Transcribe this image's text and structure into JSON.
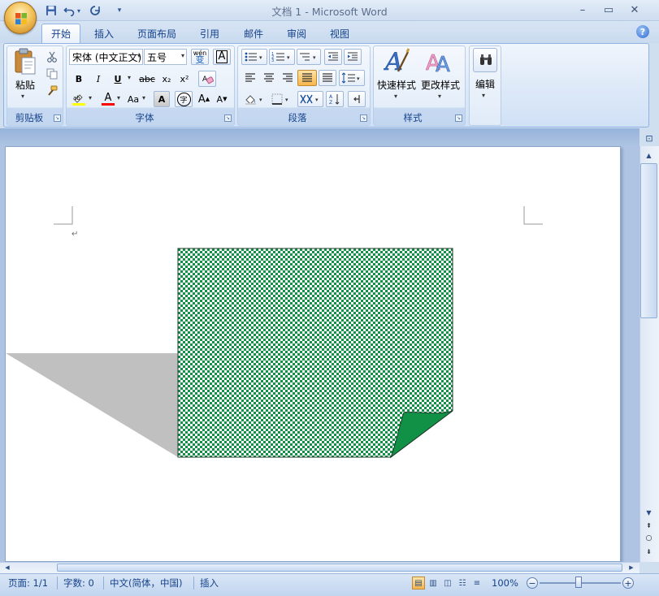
{
  "window": {
    "title": "文档 1 - Microsoft Word",
    "minimize": "–",
    "maximize": "▭",
    "close": "✕"
  },
  "quick_access": {
    "customize": "▾"
  },
  "tabs": [
    {
      "label": "开始",
      "active": true
    },
    {
      "label": "插入"
    },
    {
      "label": "页面布局"
    },
    {
      "label": "引用"
    },
    {
      "label": "邮件"
    },
    {
      "label": "审阅"
    },
    {
      "label": "视图"
    }
  ],
  "help": "?",
  "ribbon": {
    "clipboard": {
      "paste": "粘贴",
      "group": "剪贴板"
    },
    "font": {
      "font_name": "宋体 (中文正文)",
      "font_size": "五号",
      "group": "字体",
      "bold": "B",
      "italic": "I",
      "underline": "U",
      "strike": "abc",
      "subscript": "x₂",
      "superscript": "x²",
      "case": "Aa",
      "grow": "A",
      "shrink": "A",
      "char_border": "A",
      "char_shading": "A",
      "enclose": "字",
      "phonetic": "wén",
      "highlight_color": "#ffff00",
      "font_color": "#ff0000"
    },
    "paragraph": {
      "group": "段落"
    },
    "styles": {
      "quick_styles": "快速样式",
      "change_styles": "更改样式",
      "group": "样式"
    },
    "editing": {
      "label": "编辑"
    }
  },
  "document": {
    "paragraph_mark": "↵",
    "shape": {
      "fill_colors": [
        "#ffffff",
        "#119146"
      ],
      "fold_color": "#119146",
      "shadow_color": "#c0c0c0"
    }
  },
  "statusbar": {
    "page": "页面: 1/1",
    "words": "字数: 0",
    "language": "中文(简体，中国)",
    "mode": "插入",
    "zoom": "100%",
    "zoom_out": "−",
    "zoom_in": "+"
  }
}
